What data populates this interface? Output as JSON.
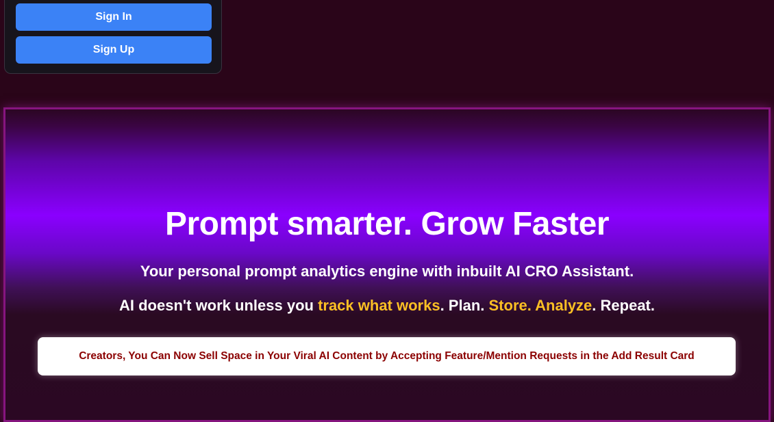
{
  "auth": {
    "sign_in_label": "Sign In",
    "sign_up_label": "Sign Up"
  },
  "hero": {
    "title": "Prompt smarter. Grow Faster",
    "subtitle": "Your personal prompt analytics engine with inbuilt AI CRO Assistant.",
    "tagline": {
      "part1": "AI doesn't work unless you ",
      "highlight1": "track what works",
      "part2": ". Plan. ",
      "highlight2": "Store. Analyze",
      "part3": ". Repeat."
    },
    "announcement": "Creators, You Can Now Sell Space in Your Viral AI Content by Accepting Feature/Mention Requests in the Add Result Card"
  },
  "colors": {
    "page_background": "#2a0519",
    "button_blue": "#3b82f6",
    "hero_purple": "#8a00ff",
    "hero_border": "#86157f",
    "highlight_yellow": "#fbbf24",
    "announcement_text": "#8b0000"
  }
}
